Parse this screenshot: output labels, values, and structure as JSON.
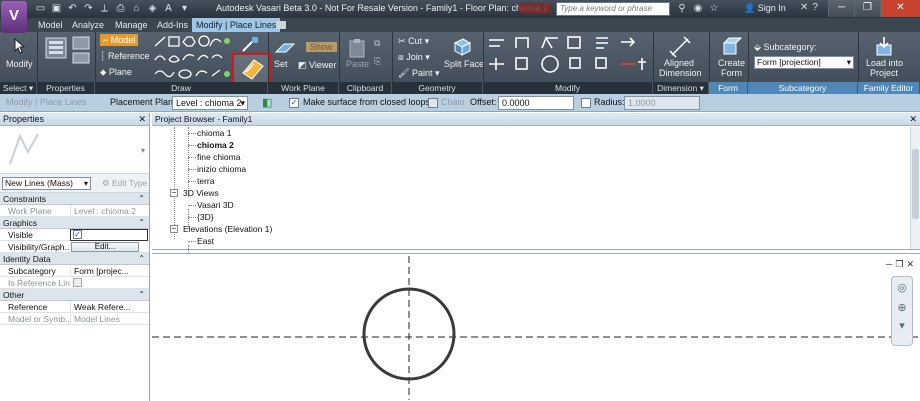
{
  "titlebar": {
    "app_icon": "V",
    "title": "Autodesk Vasari Beta 3.0 - Not For Resale Version -    Family1 - Floor Plan: chioma 2",
    "search_placeholder": "Type a keyword or phrase",
    "sign_in": "Sign In"
  },
  "tabs": [
    "Model",
    "Analyze",
    "Manage",
    "Add-Ins",
    "Modify | Place Lines"
  ],
  "active_tab_index": 4,
  "ribbon": {
    "modify_label": "Modify",
    "properties_label": "Properties",
    "draw_model": "Model",
    "draw_reference": "Reference",
    "draw_plane": "Plane",
    "set_label": "Set",
    "viewer_label": "Viewer",
    "show_label": "Show",
    "paste_label": "Paste",
    "cut_label": "Cut",
    "join_label": "Join",
    "paint_label": "Paint",
    "split_face_label": "Split Face",
    "aligned_dimension_line1": "Aligned",
    "aligned_dimension_line2": "Dimension",
    "create_form_line1": "Create",
    "create_form_line2": "Form",
    "subcategory_label": "Subcategory:",
    "subcategory_value": "Form [projection]",
    "load_into_line1": "Load into",
    "load_into_line2": "Project"
  },
  "panels": [
    "Select",
    "Properties",
    "Draw",
    "Work Plane",
    "Clipboard",
    "Geometry",
    "Modify",
    "Dimension",
    "Form",
    "Subcategory",
    "Family Editor"
  ],
  "options_bar": {
    "context": "Modify | Place Lines",
    "placement_plane_label": "Placement Plane:",
    "placement_plane_value": "Level : chioma 2",
    "make_surface_label": "Make surface from closed loops",
    "make_surface_checked": true,
    "chain_label": "Chain",
    "offset_label": "Offset:",
    "offset_value": "0.0000",
    "radius_label": "Radius:",
    "radius_value": "1.0000"
  },
  "properties": {
    "title": "Properties",
    "type_value": "New Lines (Mass)",
    "edit_type": "Edit Type",
    "sections": {
      "constraints": "Constraints",
      "graphics": "Graphics",
      "identity": "Identity Data",
      "other": "Other"
    },
    "rows": {
      "work_plane_k": "Work Plane",
      "work_plane_v": "Level : chioma 2",
      "visible_k": "Visible",
      "visible_checked": true,
      "visibility_k": "Visibility/Graph...",
      "visibility_btn": "Edit...",
      "subcategory_k": "Subcategory",
      "subcategory_v": "Form [projec...",
      "is_reference_k": "Is Reference Line",
      "reference_k": "Reference",
      "reference_v": "Weak Refere...",
      "model_sym_k": "Model or Symb...",
      "model_sym_v": "Model Lines"
    }
  },
  "browser": {
    "title": "Project Browser - Family1",
    "items": [
      {
        "label": "chioma 1",
        "bold": false
      },
      {
        "label": "chioma 2",
        "bold": true
      },
      {
        "label": "fine chioma",
        "bold": false
      },
      {
        "label": "inizio chioma",
        "bold": false
      },
      {
        "label": "terra",
        "bold": false
      },
      {
        "label": "3D Views",
        "bold": false
      },
      {
        "label": "Vasari 3D",
        "bold": false
      },
      {
        "label": "{3D}",
        "bold": false
      },
      {
        "label": "Elevations (Elevation 1)",
        "bold": false
      },
      {
        "label": "East",
        "bold": false
      }
    ]
  },
  "colors": {
    "highlight_red": "#d3171a",
    "active_tab": "#9ec6e6",
    "options_bar": "#b9cfe0"
  }
}
